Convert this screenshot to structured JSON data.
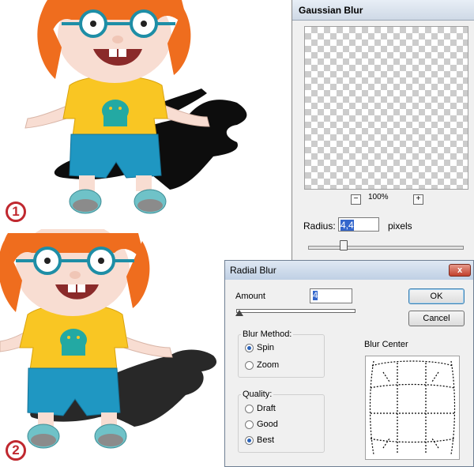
{
  "steps": [
    "1",
    "2"
  ],
  "gaussian_blur": {
    "title": "Gaussian Blur",
    "zoom_out_label": "−",
    "zoom_level": "100%",
    "zoom_in_label": "+",
    "radius_label": "Radius:",
    "radius_value": "4,4",
    "radius_unit": "pixels"
  },
  "radial_blur": {
    "title": "Radial Blur",
    "close_label": "x",
    "amount_label": "Amount",
    "amount_value": "4",
    "ok_label": "OK",
    "cancel_label": "Cancel",
    "blur_method": {
      "label": "Blur Method:",
      "options": [
        "Spin",
        "Zoom"
      ],
      "selected": "Spin"
    },
    "quality": {
      "label": "Quality:",
      "options": [
        "Draft",
        "Good",
        "Best"
      ],
      "selected": "Best"
    },
    "blur_center_label": "Blur Center"
  },
  "colors": {
    "badge": "#c0282f",
    "shirt": "#f9c623",
    "shorts": "#1f97c2",
    "hair": "#ef6d1e",
    "monster": "#23a9a3",
    "selection": "#3366cc"
  }
}
